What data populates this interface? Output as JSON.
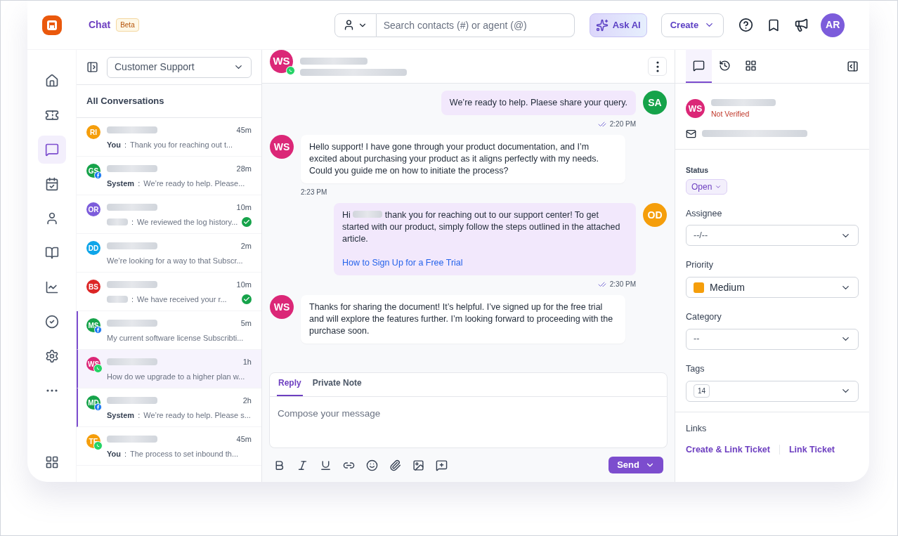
{
  "header": {
    "title": "Chat",
    "badge": "Beta",
    "search_placeholder": "Search contacts (#) or agent (@)",
    "ask_ai": "Ask AI",
    "create": "Create",
    "avatar": "AR"
  },
  "nav": [
    {
      "selected": false
    },
    {
      "selected": false
    },
    {
      "selected": true
    },
    {
      "selected": false
    },
    {
      "selected": false
    },
    {
      "selected": false
    },
    {
      "selected": false
    },
    {
      "selected": false
    },
    {
      "selected": false
    },
    {
      "selected": false
    }
  ],
  "inbox": {
    "value": "Customer Support",
    "heading": "All Conversations"
  },
  "conversations": [
    {
      "initials": "RI",
      "color": "#f59e0b",
      "kind": "plain",
      "sender": "You",
      "separator": ":",
      "preview": "Thank you for reaching out t...",
      "time": "45m",
      "resolved": false,
      "flagged": false,
      "selected": false
    },
    {
      "initials": "GS",
      "color": "#16a34a",
      "kind": "facebook",
      "sender": "System",
      "separator": ":",
      "preview": "We’re ready to help. Please...",
      "time": "28m",
      "resolved": false,
      "flagged": false,
      "selected": false
    },
    {
      "initials": "OR",
      "color": "#7c5cdb",
      "kind": "plain",
      "sender_hidden": true,
      "separator": ":",
      "preview": "We reviewed the log history...",
      "time": "10m",
      "resolved": true,
      "flagged": false,
      "selected": false
    },
    {
      "initials": "DD",
      "color": "#0ea5e9",
      "kind": "plain",
      "preview": "We’re looking for a way to that Subscr...",
      "time": "2m",
      "resolved": false,
      "flagged": false,
      "selected": false
    },
    {
      "initials": "BS",
      "color": "#dc2626",
      "kind": "plain",
      "sender_hidden": true,
      "separator": ":",
      "preview": "We have received your r...",
      "time": "10m",
      "resolved": true,
      "flagged": false,
      "selected": false
    },
    {
      "initials": "MS",
      "color": "#16a34a",
      "kind": "facebook",
      "preview": "My current software license Subscribti...",
      "time": "5m",
      "resolved": false,
      "flagged": true,
      "selected": false
    },
    {
      "initials": "WS",
      "color": "#db2777",
      "kind": "whatsapp",
      "preview": "How do we upgrade to a higher plan w...",
      "time": "1h",
      "resolved": false,
      "flagged": true,
      "selected": true
    },
    {
      "initials": "MD",
      "color": "#16a34a",
      "kind": "facebook",
      "sender": "System",
      "separator": ":",
      "preview": "We’re ready to help. Please s...",
      "time": "2h",
      "resolved": false,
      "flagged": true,
      "selected": false
    },
    {
      "initials": "TE",
      "color": "#f59e0b",
      "kind": "whatsapp",
      "sender": "You",
      "separator": ":",
      "preview": "The process to set inbound th...",
      "time": "45m",
      "resolved": false,
      "flagged": false,
      "selected": false
    }
  ],
  "chat": {
    "initials": "WS",
    "color": "#db2777",
    "kind": "whatsapp"
  },
  "messages": [
    {
      "kind": "outgoing",
      "initials": "SA",
      "color": "#16a34a",
      "text": "We’re ready to help. Plaese share your query.",
      "time": "2:20 PM"
    },
    {
      "kind": "incoming",
      "initials": "WS",
      "color": "#db2777",
      "text": "Hello support! I have gone through your product documentation, and I’m excited about purchasing your product as it aligns perfectly with my needs. Could you guide me on how to initiate the process?",
      "time": "2:23 PM"
    },
    {
      "kind": "outgoing",
      "initials": "OD",
      "color": "#f59e0b",
      "greeting": "Hi",
      "text": "thank you for reaching out to our support center! To get started with our product, simply follow the steps outlined in the attached article.",
      "link": "How to Sign Up for a Free Trial",
      "time": "2:30 PM"
    },
    {
      "kind": "incoming",
      "initials": "WS",
      "color": "#db2777",
      "text": "Thanks for sharing the document! It’s helpful. I’ve signed up for the free trial and will explore the features further. I’m looking forward to proceeding with the purchase soon."
    }
  ],
  "composer": {
    "tabs": [
      {
        "label": "Reply",
        "selected": true
      },
      {
        "label": "Private Note",
        "selected": false
      }
    ],
    "placeholder": "Compose your message",
    "send": "Send"
  },
  "details": {
    "tabs": [
      {
        "selected": true
      },
      {
        "selected": false
      },
      {
        "selected": false
      }
    ],
    "verification": "Not Verified",
    "initials": "WS",
    "color": "#db2777",
    "status_label": "Status",
    "status": "Open",
    "fields": [
      {
        "label": "Assignee",
        "value": "--/--"
      },
      {
        "label": "Priority",
        "value": "Medium",
        "color": "#f59e0b"
      },
      {
        "label": "Category",
        "value": "--"
      },
      {
        "label": "Tags",
        "value": "14",
        "kind": "tag"
      }
    ],
    "links_label": "Links",
    "links": [
      "Create & Link Ticket",
      "Link Ticket"
    ]
  }
}
